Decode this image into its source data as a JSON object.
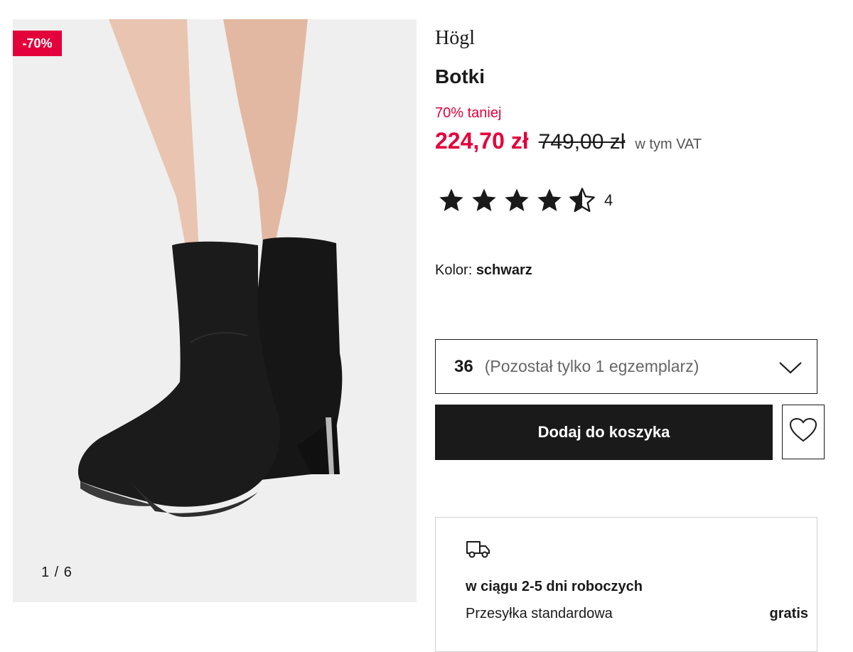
{
  "gallery": {
    "discount_badge": "-70%",
    "counter": "1 / 6"
  },
  "product": {
    "brand": "Högl",
    "name": "Botki",
    "price_note": "70% taniej",
    "price_current": "224,70 zł",
    "price_old": "749,00 zł",
    "vat_note": "w tym VAT",
    "rating_value": 4.5,
    "rating_max": 5,
    "review_count": "4",
    "color_label": "Kolor:",
    "color_value": "schwarz"
  },
  "size_select": {
    "selected": "36",
    "note": "(Pozostał tylko 1 egzemplarz)"
  },
  "actions": {
    "add_to_cart": "Dodaj do koszyka"
  },
  "delivery": {
    "time": "w ciągu 2-5 dni roboczych",
    "type": "Przesyłka standardowa",
    "price": "gratis"
  },
  "colors": {
    "accent_red": "#e4003a",
    "text_dark": "#1a1a1a",
    "image_bg": "#efefef"
  },
  "icons": [
    "star-icon",
    "half-star-icon",
    "chevron-down-icon",
    "heart-icon",
    "truck-icon"
  ]
}
